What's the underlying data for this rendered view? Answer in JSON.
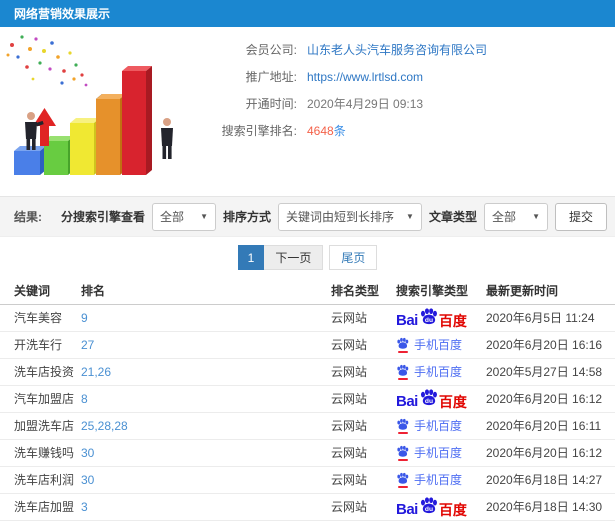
{
  "colors": {
    "header_bg": "#1b87d0",
    "link_blue": "#2e77c4",
    "rank_link_blue": "#4a90d2",
    "count_red": "#f4624a",
    "count_unit_blue": "#3a8ee6",
    "baidu_blue": "#2319dc",
    "baidu_red": "#e10602",
    "mobile_baidu_blue": "#4e6ef2",
    "pagination_active": "#337ab7"
  },
  "header": {
    "title": "网络营销效果展示"
  },
  "illustration": {
    "name": "3d-bar-chart-clipart"
  },
  "info": {
    "member_label": "会员公司:",
    "member_value": "山东老人头汽车服务咨询有限公司",
    "url_label": "推广地址:",
    "url_value": "https://www.lrtlsd.com",
    "open_label": "开通时间:",
    "open_value": "2020年4月29日 09:13",
    "rank_label": "搜索引擎排名:",
    "rank_count": "4648",
    "rank_unit": "条"
  },
  "filters": {
    "result_label": "结果:",
    "engine_view_label": "分搜索引擎查看",
    "engine_view_value": "全部",
    "sort_label": "排序方式",
    "sort_value": "关键词由短到长排序",
    "article_label": "文章类型",
    "article_value": "全部",
    "caret": "▼",
    "submit_label": "提交"
  },
  "pagination": {
    "current": "1",
    "next": "下一页",
    "last": "尾页"
  },
  "table": {
    "headers": [
      "关键词",
      "排名",
      "排名类型",
      "搜索引擎类型",
      "最新更新时间"
    ],
    "baidu_logo": {
      "bai": "Bai",
      "du": "du",
      "cn": "百度"
    },
    "mobile_label": "手机百度",
    "rows": [
      {
        "keyword": "汽车美容",
        "rank": "9",
        "rank_type": "云网站",
        "engine": "baidu",
        "updated": "2020年6月5日 11:24"
      },
      {
        "keyword": "开洗车行",
        "rank": "27",
        "rank_type": "云网站",
        "engine": "baidu-mobile",
        "updated": "2020年6月20日 16:16"
      },
      {
        "keyword": "洗车店投资",
        "rank": "21,26",
        "rank_type": "云网站",
        "engine": "baidu-mobile",
        "updated": "2020年5月27日 14:58"
      },
      {
        "keyword": "汽车加盟店",
        "rank": "8",
        "rank_type": "云网站",
        "engine": "baidu",
        "updated": "2020年6月20日 16:12"
      },
      {
        "keyword": "加盟洗车店",
        "rank": "25,28,28",
        "rank_type": "云网站",
        "engine": "baidu-mobile",
        "updated": "2020年6月20日 16:11"
      },
      {
        "keyword": "洗车赚钱吗",
        "rank": "30",
        "rank_type": "云网站",
        "engine": "baidu-mobile",
        "updated": "2020年6月20日 16:12"
      },
      {
        "keyword": "洗车店利润",
        "rank": "30",
        "rank_type": "云网站",
        "engine": "baidu-mobile",
        "updated": "2020年6月18日 14:27"
      },
      {
        "keyword": "洗车店加盟",
        "rank": "3",
        "rank_type": "云网站",
        "engine": "baidu",
        "updated": "2020年6月18日 14:30"
      }
    ]
  }
}
